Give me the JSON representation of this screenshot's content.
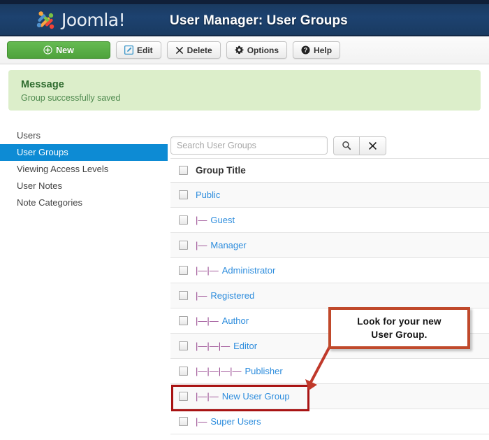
{
  "header": {
    "brand": "Joomla!",
    "brand_icon": "joomla-logo-icon",
    "title": "User Manager: User Groups"
  },
  "toolbar": {
    "buttons": [
      {
        "label": "New",
        "icon": "plus-circle-icon",
        "style": "primary"
      },
      {
        "label": "Edit",
        "icon": "pencil-square-icon",
        "style": "default"
      },
      {
        "label": "Delete",
        "icon": "x-mark-icon",
        "style": "default"
      },
      {
        "label": "Options",
        "icon": "gear-icon",
        "style": "default"
      },
      {
        "label": "Help",
        "icon": "question-circle-icon",
        "style": "default"
      }
    ]
  },
  "message": {
    "title": "Message",
    "text": "Group successfully saved",
    "background": "#dceeca",
    "title_color": "#2d6a2d"
  },
  "sidebar": {
    "items": [
      {
        "label": "Users",
        "active": false
      },
      {
        "label": "User Groups",
        "active": true
      },
      {
        "label": "Viewing Access Levels",
        "active": false
      },
      {
        "label": "User Notes",
        "active": false
      },
      {
        "label": "Note Categories",
        "active": false
      }
    ],
    "active_color": "#0d8bd4"
  },
  "search": {
    "placeholder": "Search User Groups",
    "value": "",
    "search_icon": "magnifier-icon",
    "clear_icon": "x-mark-icon"
  },
  "table": {
    "header": "Group Title",
    "rows": [
      {
        "prefix": "",
        "label": "Public",
        "level": 0
      },
      {
        "prefix": "|—",
        "label": "Guest",
        "level": 1
      },
      {
        "prefix": "|—",
        "label": "Manager",
        "level": 1
      },
      {
        "prefix": "|—|—",
        "label": "Administrator",
        "level": 2
      },
      {
        "prefix": "|—",
        "label": "Registered",
        "level": 1
      },
      {
        "prefix": "|—|—",
        "label": "Author",
        "level": 2
      },
      {
        "prefix": "|—|—|—",
        "label": "Editor",
        "level": 3
      },
      {
        "prefix": "|—|—|—|—",
        "label": "Publisher",
        "level": 4
      },
      {
        "prefix": "|—|—",
        "label": "New User Group",
        "level": 2,
        "highlighted": true
      },
      {
        "prefix": "|—",
        "label": "Super Users",
        "level": 1
      }
    ],
    "link_color": "#2e8ddd",
    "prefix_color": "#97478f"
  },
  "annotation": {
    "line1": "Look for your new",
    "line2": "User Group.",
    "border_color": "#c0492b",
    "arrow_color": "#c0392b",
    "highlight_color": "#a81313"
  }
}
